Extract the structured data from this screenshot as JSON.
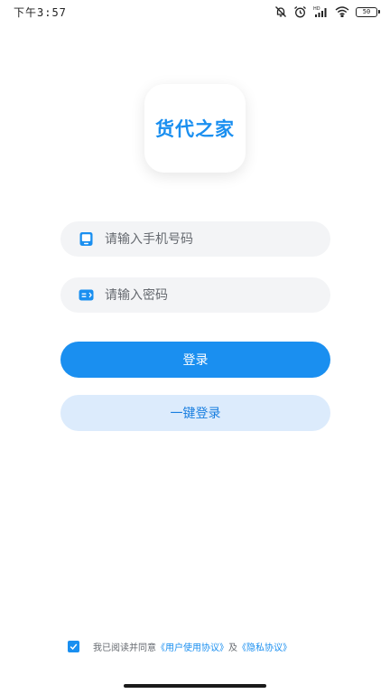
{
  "status_bar": {
    "time": "下午3:57",
    "battery": "50",
    "icons": [
      "bell-off-icon",
      "alarm-icon",
      "hd-signal-icon",
      "wifi-icon",
      "battery-icon"
    ]
  },
  "logo": {
    "text": "货代之家"
  },
  "form": {
    "phone": {
      "placeholder": "请输入手机号码",
      "value": "",
      "icon": "phone-icon"
    },
    "password": {
      "placeholder": "请输入密码",
      "value": "",
      "icon": "password-icon"
    },
    "login_label": "登录",
    "quick_login_label": "一键登录"
  },
  "agreement": {
    "checked": true,
    "prefix": "我已阅读并同意",
    "user_agreement": "《用户使用协议》",
    "conjunction": "及",
    "privacy_policy": "《隐私协议》"
  },
  "colors": {
    "primary": "#1a8ff0",
    "secondary_bg": "#dcebfc",
    "input_bg": "#f3f4f6"
  }
}
